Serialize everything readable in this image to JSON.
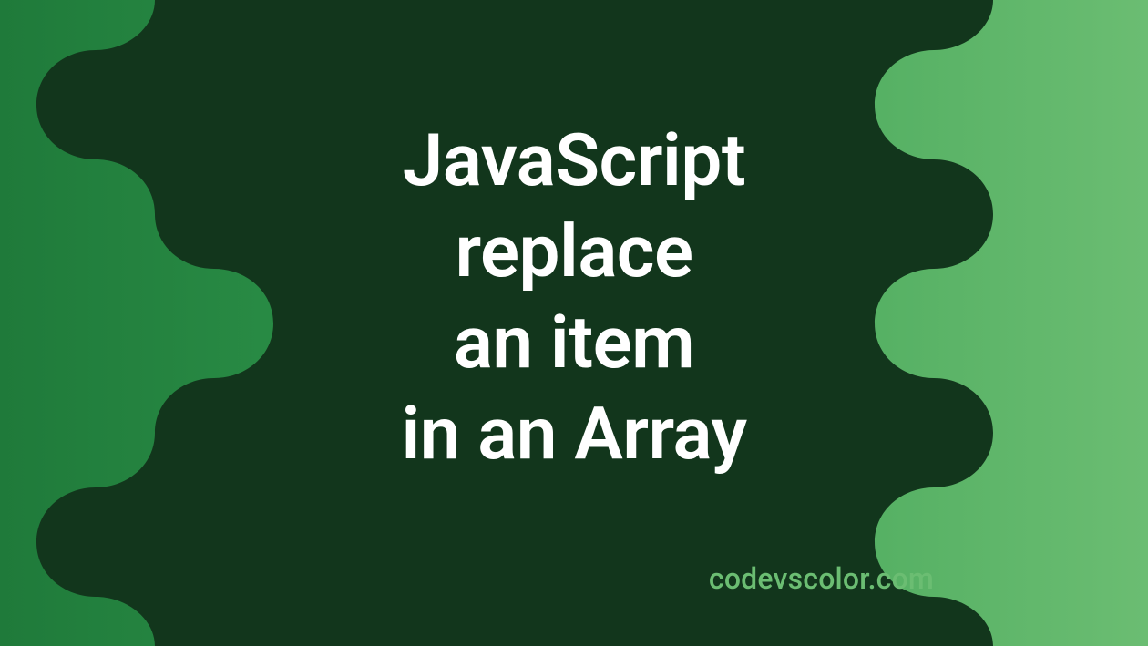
{
  "title_lines": [
    "JavaScript",
    "replace",
    "an item",
    "in an Array"
  ],
  "watermark": "codevscolor.com",
  "colors": {
    "blob": "#12361c",
    "text": "#ffffff",
    "watermark": "#6bbd72"
  }
}
